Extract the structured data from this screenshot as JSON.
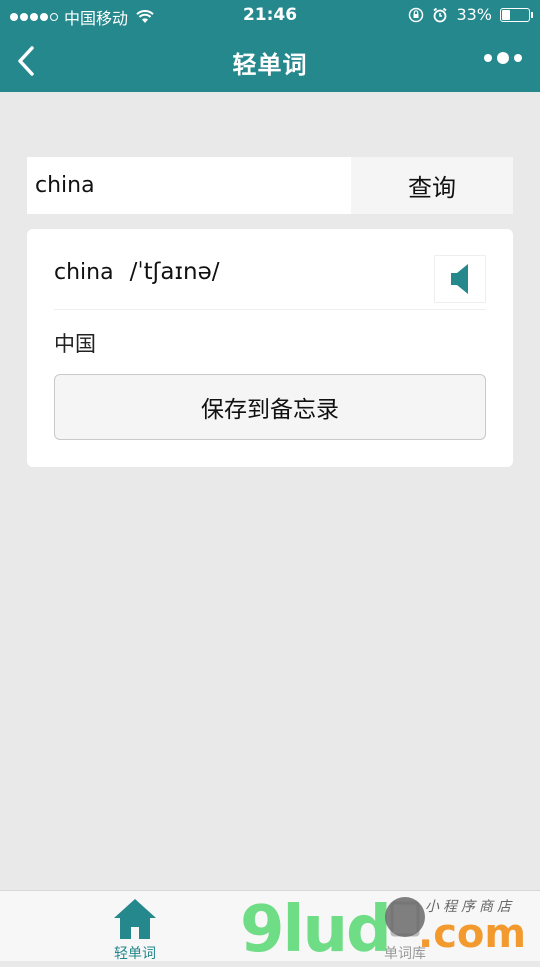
{
  "status_bar": {
    "carrier": "中国移动",
    "time": "21:46",
    "battery_text": "33%",
    "battery_level": 0.33
  },
  "nav": {
    "title": "轻单词"
  },
  "search": {
    "value": "china",
    "button_label": "查询"
  },
  "result": {
    "word": "china",
    "phonetic": "/ˈtʃaɪnə/",
    "meaning": "中国",
    "save_label": "保存到备忘录"
  },
  "tabs": [
    {
      "label": "轻单词",
      "icon": "home-icon",
      "active": true
    },
    {
      "label": "单词库",
      "icon": "book-icon",
      "active": false
    }
  ],
  "colors": {
    "primary": "#24888d",
    "background": "#e9e9e9"
  },
  "watermark": {
    "logo": "9lud",
    "domain": ".com",
    "tagline": "小程序商店"
  }
}
